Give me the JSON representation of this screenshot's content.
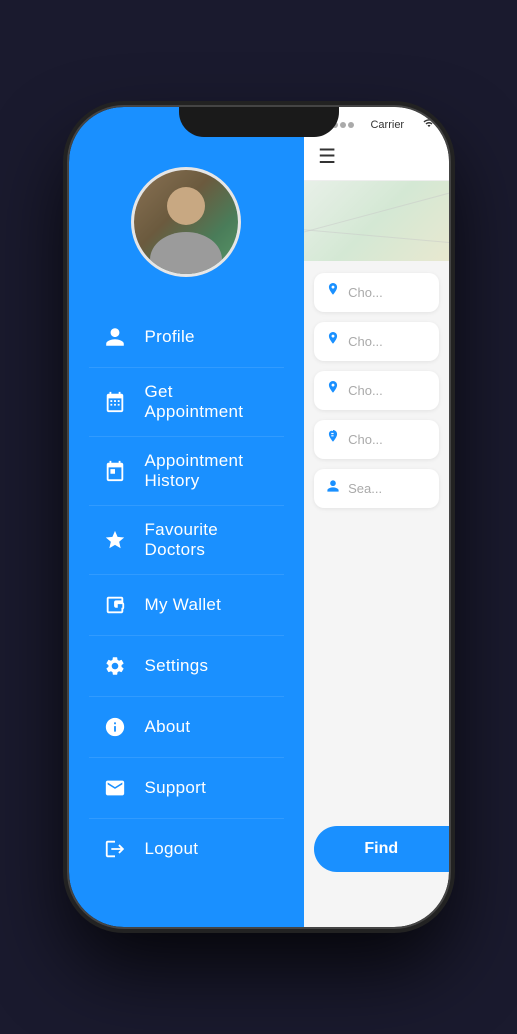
{
  "phone": {
    "status_bar": {
      "carrier": "Carrier",
      "wifi_icon": "wifi",
      "signal": "●●○○○"
    }
  },
  "drawer": {
    "avatar_alt": "User profile photo",
    "menu_items": [
      {
        "id": "profile",
        "label": "Profile",
        "icon": "👤"
      },
      {
        "id": "get-appointment",
        "label": "Get Appointment",
        "icon": "📅"
      },
      {
        "id": "appointment-history",
        "label": "Appointment History",
        "icon": "📋"
      },
      {
        "id": "favourite-doctors",
        "label": "Favourite Doctors",
        "icon": "⭐"
      },
      {
        "id": "my-wallet",
        "label": "My Wallet",
        "icon": "👛"
      },
      {
        "id": "settings",
        "label": "Settings",
        "icon": "⚙️"
      },
      {
        "id": "about",
        "label": "About",
        "icon": "ℹ️"
      },
      {
        "id": "support",
        "label": "Support",
        "icon": "✉️"
      },
      {
        "id": "logout",
        "label": "Logout",
        "icon": "🚪"
      }
    ]
  },
  "main": {
    "hamburger_label": "☰",
    "search_rows": [
      {
        "icon": "📍",
        "placeholder": "Cho..."
      },
      {
        "icon": "📍",
        "placeholder": "Cho..."
      },
      {
        "icon": "📍",
        "placeholder": "Cho..."
      },
      {
        "icon": "🏥",
        "placeholder": "Cho..."
      },
      {
        "icon": "👤",
        "placeholder": "Sea..."
      }
    ],
    "find_button_label": "Find"
  },
  "colors": {
    "primary": "#1a90ff",
    "drawer_bg": "#1a90ff",
    "white": "#ffffff",
    "text_dark": "#333333"
  }
}
